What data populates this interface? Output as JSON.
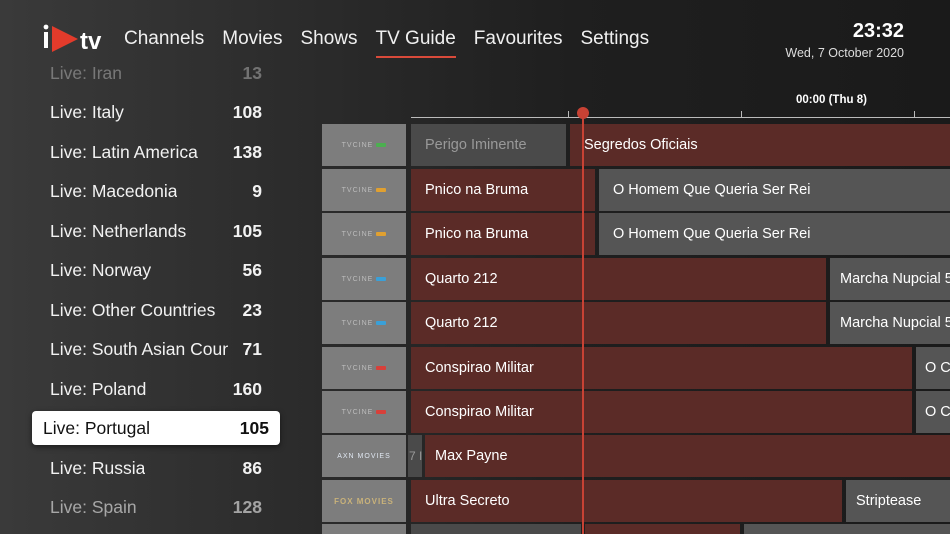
{
  "nav": {
    "items": [
      {
        "label": "Channels"
      },
      {
        "label": "Movies"
      },
      {
        "label": "Shows"
      },
      {
        "label": "TV Guide",
        "active": true
      },
      {
        "label": "Favourites"
      },
      {
        "label": "Settings"
      }
    ]
  },
  "clock": {
    "time": "23:32",
    "date": "Wed, 7 October 2020"
  },
  "categories": [
    {
      "name": "Live: Iran",
      "count": "13"
    },
    {
      "name": "Live: Italy",
      "count": "108"
    },
    {
      "name": "Live: Latin America",
      "count": "138"
    },
    {
      "name": "Live: Macedonia",
      "count": "9"
    },
    {
      "name": "Live: Netherlands",
      "count": "105"
    },
    {
      "name": "Live: Norway",
      "count": "56"
    },
    {
      "name": "Live: Other Countries",
      "count": "23"
    },
    {
      "name": "Live: South Asian Countr",
      "count": "71"
    },
    {
      "name": "Live: Poland",
      "count": "160"
    },
    {
      "name": "Live: Portugal",
      "count": "105",
      "selected": true
    },
    {
      "name": "Live: Russia",
      "count": "86"
    },
    {
      "name": "Live: Spain",
      "count": "128"
    }
  ],
  "guide": {
    "timeline_label": "00:00 (Thu 8)",
    "channels": [
      {
        "logo": "TVCINE",
        "programs": [
          "Perigo Iminente",
          "Segredos Oficiais"
        ]
      },
      {
        "logo": "TVCINE",
        "programs": [
          "Pnico na Bruma",
          "O Homem Que Queria Ser Rei"
        ]
      },
      {
        "logo": "TVCINE",
        "programs": [
          "Pnico na Bruma",
          "O Homem Que Queria Ser Rei"
        ]
      },
      {
        "logo": "TVCINE",
        "programs": [
          "Quarto 212",
          "Marcha Nupcial 5"
        ]
      },
      {
        "logo": "TVCINE",
        "programs": [
          "Quarto 212",
          "Marcha Nupcial 5"
        ]
      },
      {
        "logo": "TVCINE",
        "programs": [
          "Conspirao Militar",
          "O C"
        ]
      },
      {
        "logo": "TVCINE",
        "programs": [
          "Conspirao Militar",
          "O C"
        ]
      },
      {
        "logo": "AXN MOVIES",
        "programs": [
          "7 I",
          "Max Payne"
        ]
      },
      {
        "logo": "FOX MOVIES",
        "programs": [
          "Ultra Secreto",
          "Striptease"
        ]
      }
    ]
  },
  "colors": {
    "accent": "#c84234",
    "current_program": "#5b2b27",
    "future_program": "#555555"
  }
}
